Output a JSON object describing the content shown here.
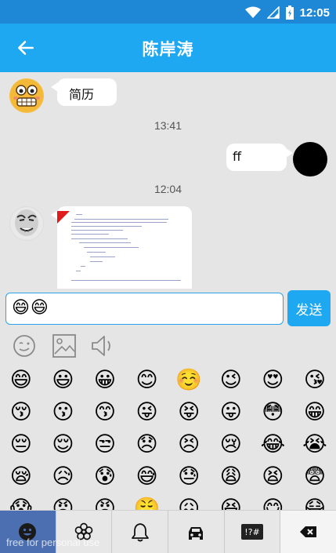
{
  "status_bar": {
    "time": "12:05",
    "icons": [
      "wifi-icon",
      "signal-icon",
      "battery-icon"
    ]
  },
  "app_bar": {
    "title": "陈岸涛",
    "back_icon": "arrow-left-icon"
  },
  "messages": [
    {
      "side": "left",
      "type": "text",
      "text": "简历"
    },
    {
      "type": "time",
      "text": "13:41"
    },
    {
      "side": "right",
      "type": "text",
      "text": "ff"
    },
    {
      "type": "time",
      "text": "12:04"
    },
    {
      "side": "left",
      "type": "image"
    }
  ],
  "input": {
    "value": "😄😄"
  },
  "send_button": {
    "label": "发送"
  },
  "tools": [
    "emoji-face-icon",
    "image-icon",
    "voice-icon"
  ],
  "emoji_grid": [
    "😄",
    "😃",
    "😀",
    "😊",
    "☺️",
    "😉",
    "😍",
    "😘",
    "😚",
    "😗",
    "😙",
    "😜",
    "😝",
    "😛",
    "😳",
    "😁",
    "😔",
    "😌",
    "😒",
    "😞",
    "😣",
    "😢",
    "😂",
    "😭",
    "😪",
    "😥",
    "😰",
    "😅",
    "😓",
    "😩",
    "😫",
    "😨",
    "😱",
    "😠",
    "😡",
    "😤",
    "😖",
    "😆",
    "😋",
    "😷"
  ],
  "bottom_tabs": [
    "smiley-tab-icon",
    "flower-tab-icon",
    "bell-tab-icon",
    "car-tab-icon",
    "symbols-tab-icon",
    "delete-key-icon"
  ],
  "symbols_tab_label": "!?#",
  "watermark": "free for personal use",
  "colors": {
    "primary": "#1ea8f2",
    "status_bar": "#1e88d6",
    "active_tab": "#4b6fb0"
  }
}
